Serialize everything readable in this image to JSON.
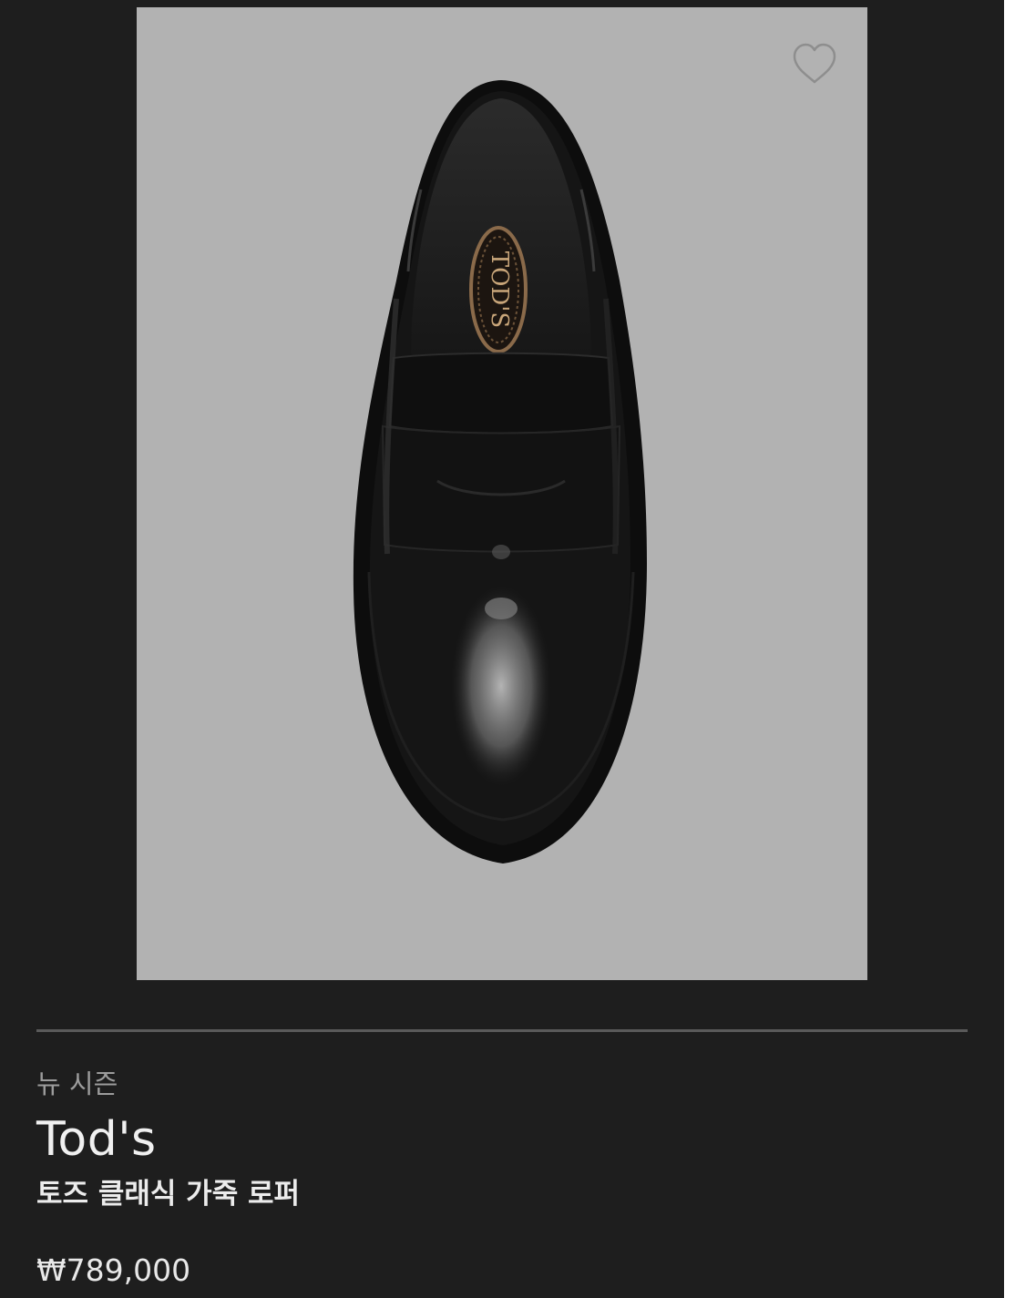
{
  "product": {
    "season_label": "뉴 시즌",
    "brand": "Tod's",
    "name": "토즈 클래식 가죽 로퍼",
    "price": "₩789,000",
    "image_logo_text": "TOD'S"
  },
  "icons": {
    "wishlist": "heart-outline-icon"
  },
  "colors": {
    "card_background": "#1e1e1e",
    "image_background": "#b2b2b2",
    "divider": "#5a5a5a"
  }
}
